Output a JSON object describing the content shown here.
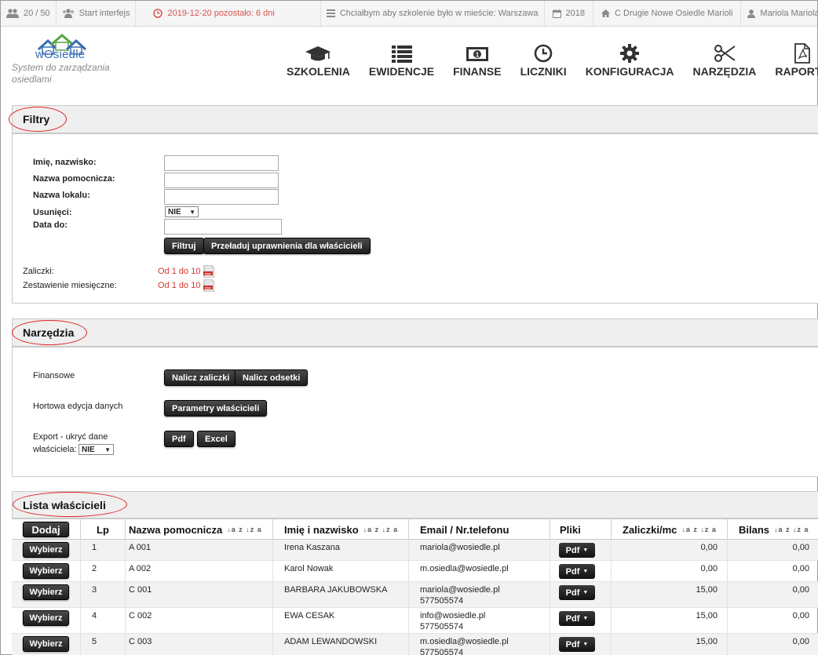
{
  "topbar": {
    "users": "20 / 50",
    "interface": "Start interfejs",
    "expiry": "2019-12-20 pozostało: 6 dni",
    "wish": "Chciałbym aby szkolenie było w mieście: Warszawa",
    "year": "2018",
    "community": "C Drugie Nowe Osiedle Marioli",
    "user": "Mariola Mariola",
    "warn_color": "#d9534f"
  },
  "header": {
    "logo_text": "wOsiedle",
    "tagline": "System do zarządzania osiedlami",
    "nav": [
      {
        "label": "SZKOLENIA",
        "icon": "graduation-cap-icon"
      },
      {
        "label": "EWIDENCJE",
        "icon": "list-icon"
      },
      {
        "label": "FINANSE",
        "icon": "money-icon"
      },
      {
        "label": "LICZNIKI",
        "icon": "clock-icon"
      },
      {
        "label": "KONFIGURACJA",
        "icon": "gear-icon"
      },
      {
        "label": "NARZĘDZIA",
        "icon": "scissors-icon"
      },
      {
        "label": "RAPORTY",
        "icon": "pdf-file-icon"
      }
    ]
  },
  "filters": {
    "title": "Filtry",
    "name_label": "Imię, nazwisko:",
    "aux_name_label": "Nazwa pomocnicza:",
    "unit_name_label": "Nazwa lokalu:",
    "deleted_label": "Usunięci:",
    "deleted_value": "NIE",
    "date_label": "Data do:",
    "filter_button": "Filtruj",
    "reload_button": "Przeładuj uprawnienia dla właścicieli",
    "advances_label": "Zaliczki:",
    "advances_link": "Od 1 do 10",
    "monthly_label": "Zestawienie miesięczne:",
    "monthly_link": "Od 1 do 10"
  },
  "tools": {
    "title": "Narzędzia",
    "finance_label": "Finansowe",
    "charge_advances_button": "Nalicz zaliczki",
    "charge_interest_button": "Nalicz odsetki",
    "bulk_edit_label": "Hortowa edycja danych",
    "owner_params_button": "Parametry właścicieli",
    "export_label_1": "Export - ukryć dane",
    "export_label_2": "właściciela:",
    "export_hide_value": "NIE",
    "pdf_button": "Pdf",
    "excel_button": "Excel"
  },
  "owners": {
    "title": "Lista właścicieli",
    "add_button": "Dodaj",
    "columns": {
      "lp": "Lp",
      "aux_name": "Nazwa pomocnicza",
      "full_name": "Imię i nazwisko",
      "contact": "Email / Nr.telefonu",
      "files": "Pliki",
      "advances": "Zaliczki/mc",
      "balance": "Bilans"
    },
    "sort_glyph": "↓a z ↓z a",
    "select_label": "Wybierz",
    "files_label": "Pdf",
    "rows": [
      {
        "lp": "1",
        "aux": "A 001",
        "name": "Irena Kaszana",
        "email": "mariola@wosiedle.pl",
        "phone": "",
        "advances": "0,00",
        "balance": "0,00"
      },
      {
        "lp": "2",
        "aux": "A 002",
        "name": "Karol Nowak",
        "email": "m.osiedla@wosiedle.pl",
        "phone": "",
        "advances": "0,00",
        "balance": "0,00"
      },
      {
        "lp": "3",
        "aux": "C 001",
        "name": "BARBARA JAKUBOWSKA",
        "email": "mariola@wosiedle.pl",
        "phone": "577505574",
        "advances": "15,00",
        "balance": "0,00"
      },
      {
        "lp": "4",
        "aux": "C 002",
        "name": "EWA CESAK",
        "email": "info@wosiedle.pl",
        "phone": "577505574",
        "advances": "15,00",
        "balance": "0,00"
      },
      {
        "lp": "5",
        "aux": "C 003",
        "name": "ADAM LEWANDOWSKI",
        "email": "m.osiedla@wosiedle.pl",
        "phone": "577505574",
        "advances": "15,00",
        "balance": "0,00"
      }
    ]
  }
}
